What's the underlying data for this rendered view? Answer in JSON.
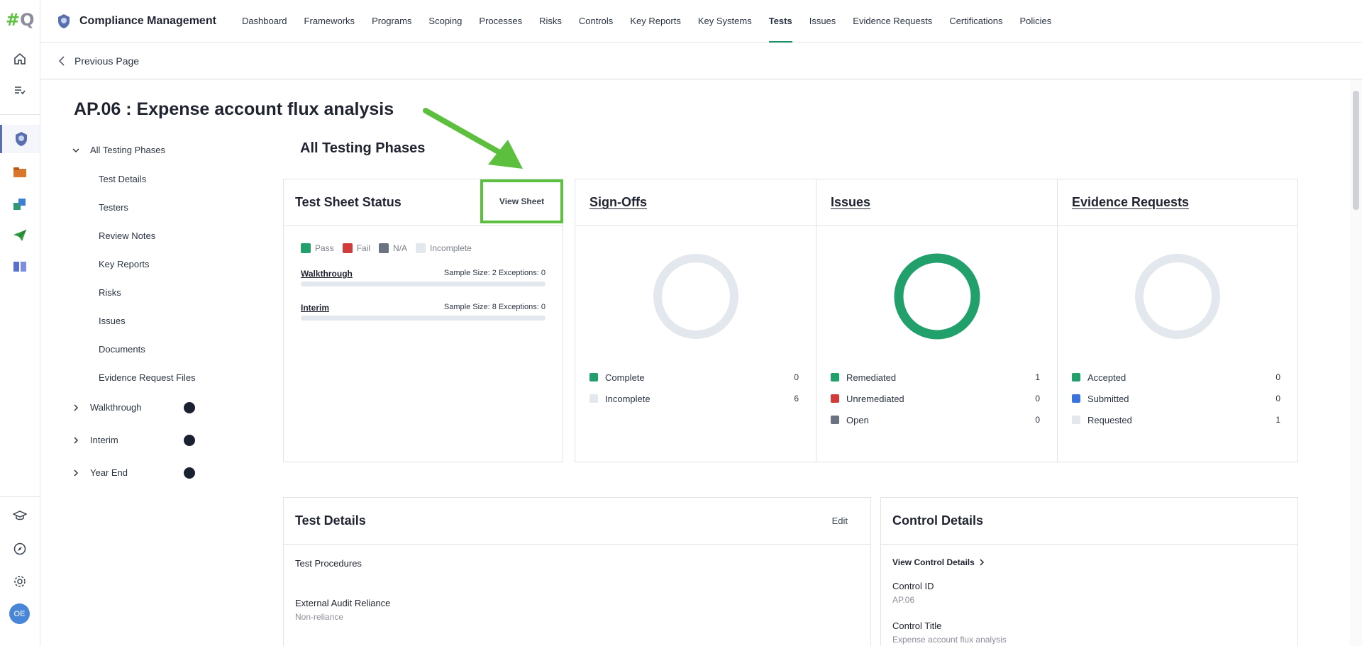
{
  "colors": {
    "pass": "#22a06b",
    "fail": "#d03b3b",
    "na": "#6b7280",
    "incomplete": "#e3e7ee",
    "submitted": "#3b74e0",
    "accent_green": "#5cbf3d"
  },
  "rail": {
    "avatar_initials": "OE",
    "icons": [
      "home-icon",
      "checklist-icon",
      "compliance-badge-icon",
      "folder-icon",
      "sync-boxes-icon",
      "paper-plane-icon",
      "book-icon",
      "graduation-cap-icon",
      "compass-icon",
      "gear-icon"
    ]
  },
  "header": {
    "app_title": "Compliance Management",
    "nav": [
      "Dashboard",
      "Frameworks",
      "Programs",
      "Scoping",
      "Processes",
      "Risks",
      "Controls",
      "Key Reports",
      "Key Systems",
      "Tests",
      "Issues",
      "Evidence Requests",
      "Certifications",
      "Policies"
    ],
    "active_nav": "Tests"
  },
  "prev_page": "Previous Page",
  "page_title": "AP.06 : Expense account flux analysis",
  "tree": {
    "root": "All Testing Phases",
    "children": [
      "Test Details",
      "Testers",
      "Review Notes",
      "Key Reports",
      "Risks",
      "Issues",
      "Documents",
      "Evidence Request Files"
    ],
    "phases": [
      "Walkthrough",
      "Interim",
      "Year End"
    ]
  },
  "section_title": "All Testing Phases",
  "test_sheet": {
    "title": "Test Sheet Status",
    "view_button": "View Sheet",
    "legend": [
      "Pass",
      "Fail",
      "N/A",
      "Incomplete"
    ],
    "rows": [
      {
        "name": "Walkthrough",
        "meta": "Sample Size: 2   Exceptions: 0"
      },
      {
        "name": "Interim",
        "meta": "Sample Size: 8   Exceptions: 0"
      }
    ]
  },
  "signoffs": {
    "title": "Sign-Offs",
    "legend": [
      {
        "label": "Complete",
        "value": "0"
      },
      {
        "label": "Incomplete",
        "value": "6"
      }
    ]
  },
  "issues": {
    "title": "Issues",
    "legend": [
      {
        "label": "Remediated",
        "value": "1"
      },
      {
        "label": "Unremediated",
        "value": "0"
      },
      {
        "label": "Open",
        "value": "0"
      }
    ]
  },
  "evidence": {
    "title": "Evidence Requests",
    "legend": [
      {
        "label": "Accepted",
        "value": "0"
      },
      {
        "label": "Submitted",
        "value": "0"
      },
      {
        "label": "Requested",
        "value": "1"
      }
    ]
  },
  "test_details": {
    "title": "Test Details",
    "edit": "Edit",
    "procedures_label": "Test Procedures",
    "reliance_label": "External Audit Reliance",
    "reliance_value": "Non-reliance"
  },
  "control_details": {
    "title": "Control Details",
    "view_link": "View Control Details",
    "id_label": "Control ID",
    "id_value": "AP.06",
    "title_label": "Control Title",
    "title_value": "Expense account flux analysis"
  }
}
